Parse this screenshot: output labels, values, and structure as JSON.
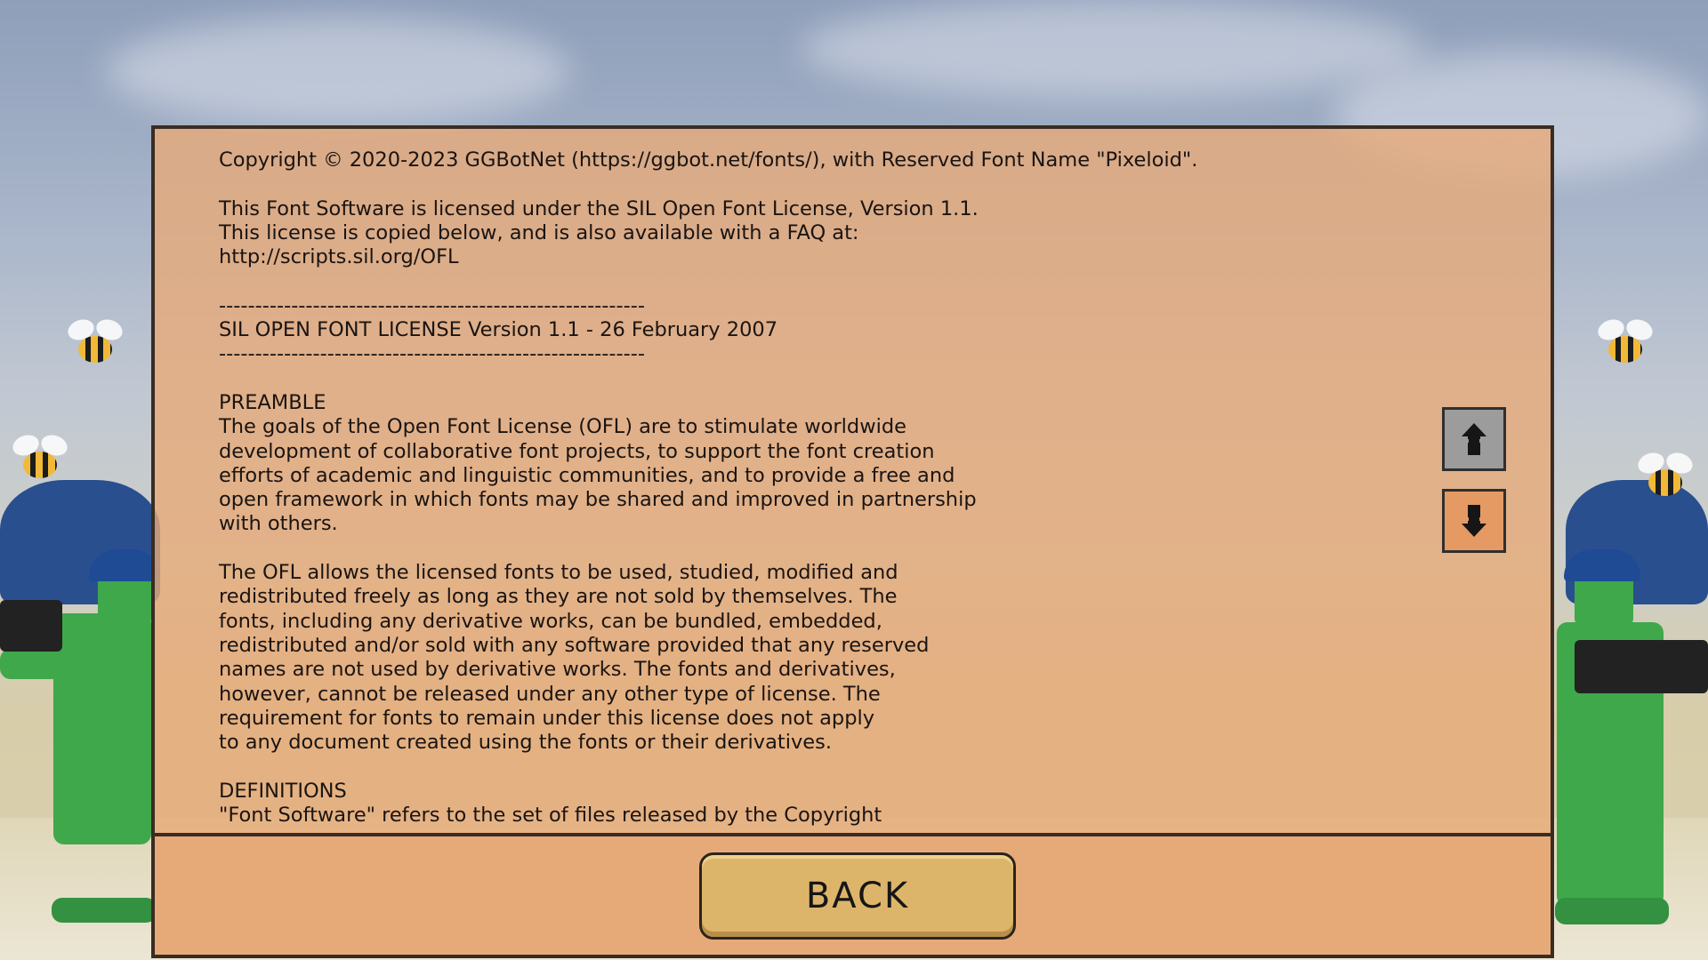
{
  "license": {
    "lines": [
      "Copyright © 2020-2023 GGBotNet (https://ggbot.net/fonts/), with Reserved Font Name \"Pixeloid\".",
      "",
      "This Font Software is licensed under the SIL Open Font License, Version 1.1.",
      "This license is copied below, and is also available with a FAQ at:",
      "http://scripts.sil.org/OFL",
      "",
      "-----------------------------------------------------------",
      "SIL OPEN FONT LICENSE Version 1.1 - 26 February 2007",
      "-----------------------------------------------------------",
      "",
      "PREAMBLE",
      "The goals of the Open Font License (OFL) are to stimulate worldwide",
      "development of collaborative font projects, to support the font creation",
      "efforts of academic and linguistic communities, and to provide a free and",
      "open framework in which fonts may be shared and improved in partnership",
      "with others.",
      "",
      "The OFL allows the licensed fonts to be used, studied, modified and",
      "redistributed freely as long as they are not sold by themselves. The",
      "fonts, including any derivative works, can be bundled, embedded,",
      "redistributed and/or sold with any software provided that any reserved",
      "names are not used by derivative works. The fonts and derivatives,",
      "however, cannot be released under any other type of license. The",
      "requirement for fonts to remain under this license does not apply",
      "to any document created using the fonts or their derivatives.",
      "",
      "DEFINITIONS",
      "\"Font Software\" refers to the set of files released by the Copyright"
    ]
  },
  "scroll": {
    "up_icon": "arrow-up-icon",
    "down_icon": "arrow-down-icon"
  },
  "footer": {
    "back_label": "BACK"
  },
  "colors": {
    "panel_bg": "#e7aa78",
    "border": "#3a2c22",
    "back_button": "#ddb56a",
    "scroll_up_bg": "#9c9c9c",
    "scroll_down_bg": "#e59a63"
  }
}
